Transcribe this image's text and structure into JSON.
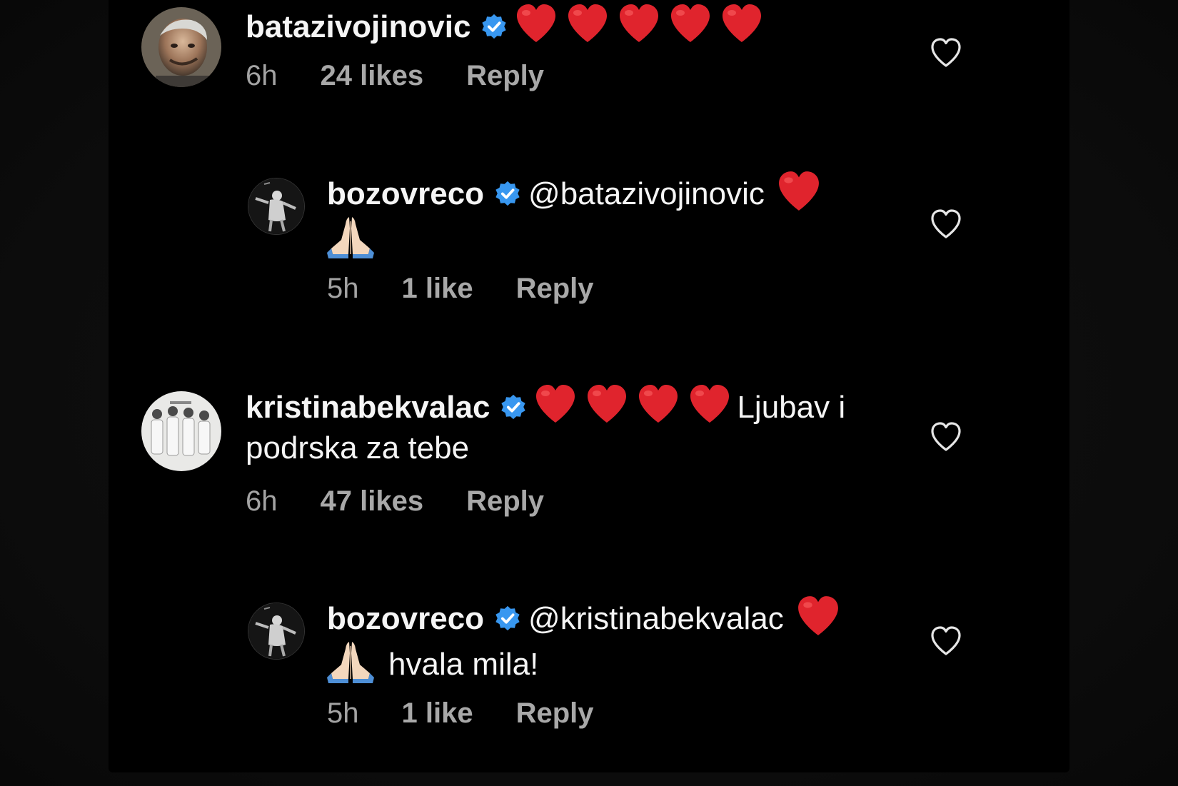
{
  "comments": [
    {
      "username": "batazivojinovic",
      "verified": true,
      "hearts": 5,
      "body": "",
      "time": "6h",
      "likes": "24 likes",
      "reply": "Reply",
      "avatar_icon": "older-man-portrait"
    },
    {
      "username": "bozovreco",
      "verified": true,
      "mention": "@batazivojinovic",
      "body": "",
      "emoji": [
        "red-heart",
        "folded-hands"
      ],
      "time": "5h",
      "likes": "1 like",
      "reply": "Reply",
      "avatar_icon": "dancer-photo"
    },
    {
      "username": "kristinabekvalac",
      "verified": true,
      "hearts": 4,
      "body": "Ljubav i podrska za tebe",
      "time": "6h",
      "likes": "47 likes",
      "reply": "Reply",
      "avatar_icon": "group-photo"
    },
    {
      "username": "bozovreco",
      "verified": true,
      "mention": "@kristinabekvalac",
      "body": "hvala mila!",
      "emoji": [
        "red-heart",
        "folded-hands"
      ],
      "time": "5h",
      "likes": "1 like",
      "reply": "Reply",
      "avatar_icon": "dancer-photo"
    }
  ],
  "colors": {
    "background": "#000000",
    "text": "#f5f5f5",
    "meta": "#a8a8a8",
    "verified": "#3897f0",
    "heart": "#e0242d"
  }
}
